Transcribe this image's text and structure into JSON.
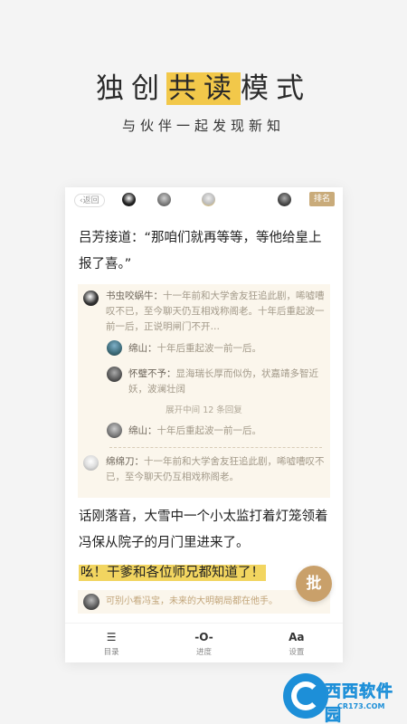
{
  "header": {
    "title_pre": "独创",
    "title_highlight": "共读",
    "title_post": "模式",
    "subtitle": "与伙伴一起发现新知"
  },
  "topbar": {
    "back_label": "‹返回",
    "rank_label": "排名"
  },
  "book": {
    "para1": "吕芳接道：“那咱们就再等等，等他给皇上报了喜。”",
    "para2": "话刚落音，大雪中一个小太监打着灯笼领着冯保从院子的月门里进来了。",
    "para3": "吆！干爹和各位师兄都知道了！"
  },
  "comments": {
    "c1_name": "书虫咬蜗牛：",
    "c1_text": "十一年前和大学舍友狂追此剧，唏嘘嘈叹不已，至今聊天仍互相戏称阁老。十年后重起波一前一后，正说明闸门不开…",
    "r1_name": "绵山：",
    "r1_text": "十年后重起波一前一后。",
    "r2_name": "怀璧不予：",
    "r2_text": "显海瑞长厚而似伪，状嘉靖多智近妖，波澜壮阔",
    "expand": "展开中间 12 条回复",
    "r3_name": "绵山：",
    "r3_text": "十年后重起波一前一后。",
    "c2_name": "绵绵刀：",
    "c2_text": "十一年前和大学舍友狂追此剧，唏嘘嘈叹不已，至今聊天仍互相戏称阁老。",
    "bottom": "可别小看冯宝，未来的大明朝局都在他手。"
  },
  "fab": {
    "label": "批"
  },
  "tabs": [
    {
      "icon": "☰",
      "label": "目录"
    },
    {
      "icon": "-O-",
      "label": "进度"
    },
    {
      "icon": "Aa",
      "label": "设置"
    }
  ],
  "watermark": {
    "brand": "西西软件园",
    "domain": "CR173.COM"
  }
}
